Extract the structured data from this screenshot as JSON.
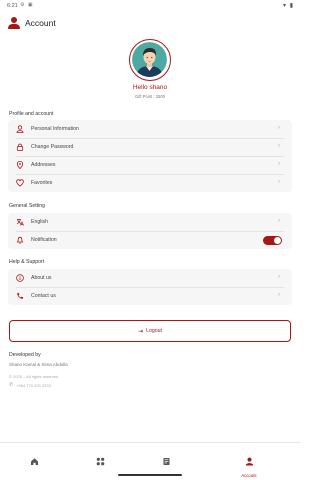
{
  "status_bar": {
    "time": "6:21",
    "icons": "⚙ ▣",
    "right_icons": "▾ ▮"
  },
  "header": {
    "title": "Account"
  },
  "profile": {
    "greeting": "Hello shano",
    "gift_points": "Gift Point : 2500"
  },
  "sections": {
    "profile": {
      "title": "Profile and account",
      "items": [
        {
          "label": "Personal Information",
          "icon": "person-icon"
        },
        {
          "label": "Change Password",
          "icon": "lock-icon"
        },
        {
          "label": "Addresses",
          "icon": "location-pin-icon"
        },
        {
          "label": "Favorites",
          "icon": "heart-icon"
        }
      ]
    },
    "general": {
      "title": "General Setting",
      "items": [
        {
          "label": "English",
          "icon": "language-icon"
        },
        {
          "label": "Notification",
          "icon": "bell-icon",
          "toggle": true
        }
      ]
    },
    "help": {
      "title": "Help & Support",
      "items": [
        {
          "label": "About us",
          "icon": "info-icon"
        },
        {
          "label": "Contact us",
          "icon": "phone-icon"
        }
      ]
    }
  },
  "logout": {
    "label": "Logout",
    "icon": "logout-icon"
  },
  "footer": {
    "developed_by": "Developed by",
    "names": "Shano Kamal & Sima Abdulla",
    "copyright": "© 2025 – All rights reserved",
    "phone": "+964 770 333 3333"
  },
  "bottom_nav": {
    "items": [
      {
        "icon": "home-icon",
        "label": ""
      },
      {
        "icon": "grid-icon",
        "label": ""
      },
      {
        "icon": "orders-icon",
        "label": ""
      },
      {
        "icon": "account-icon",
        "label": "Account",
        "active": true
      }
    ]
  },
  "colors": {
    "accent": "#a81616",
    "row_bg": "#f6f6f6"
  }
}
